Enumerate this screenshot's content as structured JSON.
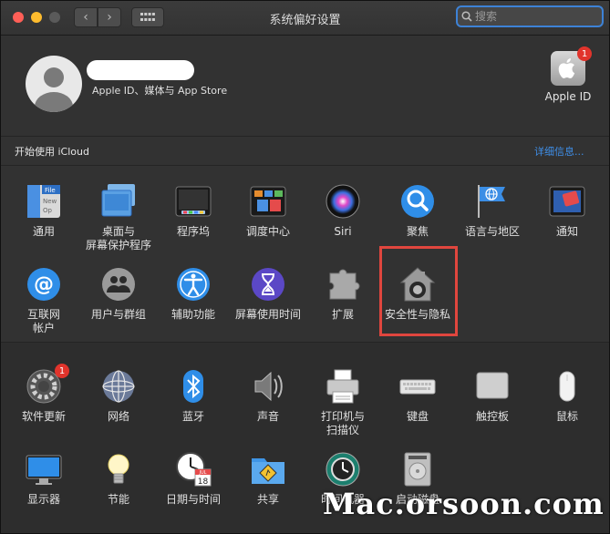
{
  "window": {
    "title": "系统偏好设置"
  },
  "search": {
    "placeholder": "搜索"
  },
  "account": {
    "subtitle": "Apple ID、媒体与 App Store",
    "apple_id_label": "Apple ID",
    "apple_id_badge": "1"
  },
  "icloud": {
    "prompt": "开始使用 iCloud",
    "details_link": "详细信息..."
  },
  "row1": [
    {
      "label": "通用",
      "icon": "general-icon"
    },
    {
      "label": "桌面与\n屏幕保护程序",
      "icon": "desktop-screensaver-icon"
    },
    {
      "label": "程序坞",
      "icon": "dock-icon"
    },
    {
      "label": "调度中心",
      "icon": "mission-control-icon"
    },
    {
      "label": "Siri",
      "icon": "siri-icon"
    },
    {
      "label": "聚焦",
      "icon": "spotlight-icon"
    },
    {
      "label": "语言与地区",
      "icon": "language-region-icon"
    },
    {
      "label": "通知",
      "icon": "notifications-icon"
    }
  ],
  "row2": [
    {
      "label": "互联网\n帐户",
      "icon": "internet-accounts-icon"
    },
    {
      "label": "用户与群组",
      "icon": "users-groups-icon"
    },
    {
      "label": "辅助功能",
      "icon": "accessibility-icon"
    },
    {
      "label": "屏幕使用时间",
      "icon": "screen-time-icon"
    },
    {
      "label": "扩展",
      "icon": "extensions-icon"
    },
    {
      "label": "安全性与隐私",
      "icon": "security-privacy-icon"
    }
  ],
  "row3": [
    {
      "label": "软件更新",
      "icon": "software-update-icon",
      "badge": "1"
    },
    {
      "label": "网络",
      "icon": "network-icon"
    },
    {
      "label": "蓝牙",
      "icon": "bluetooth-icon"
    },
    {
      "label": "声音",
      "icon": "sound-icon"
    },
    {
      "label": "打印机与\n扫描仪",
      "icon": "printers-scanners-icon"
    },
    {
      "label": "键盘",
      "icon": "keyboard-icon"
    },
    {
      "label": "触控板",
      "icon": "trackpad-icon"
    },
    {
      "label": "鼠标",
      "icon": "mouse-icon"
    }
  ],
  "row4": [
    {
      "label": "显示器",
      "icon": "displays-icon"
    },
    {
      "label": "节能",
      "icon": "energy-saver-icon"
    },
    {
      "label": "日期与时间",
      "icon": "date-time-icon",
      "calendar_month": "JUL",
      "calendar_day": "18"
    },
    {
      "label": "共享",
      "icon": "sharing-icon"
    },
    {
      "label": "时间机器",
      "icon": "time-machine-icon"
    },
    {
      "label": "启动磁盘",
      "icon": "startup-disk-icon"
    }
  ],
  "row1_extra": {
    "general_file_text": "File",
    "general_new_text": "New",
    "general_op_text": "Op"
  },
  "watermark": "Mac.orsoon.com",
  "colors": {
    "accent": "#3f8fe8",
    "highlight": "#e0463e",
    "badge": "#e1342c"
  }
}
